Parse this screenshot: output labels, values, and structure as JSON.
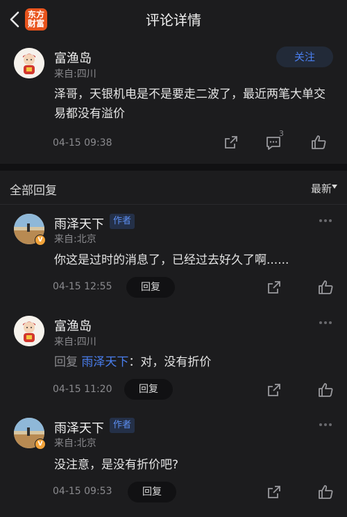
{
  "header": {
    "title": "评论详情",
    "logo_line1": "东方",
    "logo_line2": "财富"
  },
  "post": {
    "username": "富渔岛",
    "location": "来自:四川",
    "follow_label": "关注",
    "content": "泽哥，天银机电是不是要走二波了，最近两笔大单交易都没有溢价",
    "time": "04-15 09:38",
    "comment_count": "3"
  },
  "replies_section": {
    "title": "全部回复",
    "sort": "最新"
  },
  "replies": [
    {
      "username": "雨泽天下",
      "tag": "作者",
      "location": "来自:北京",
      "content": "你这是过时的消息了，已经过去好久了啊......",
      "time": "04-15 12:55",
      "reply_label": "回复"
    },
    {
      "username": "富渔岛",
      "location": "来自:四川",
      "reply_prefix": "回复",
      "reply_target": "雨泽天下",
      "content": "：对，没有折价",
      "time": "04-15 11:20",
      "reply_label": "回复"
    },
    {
      "username": "雨泽天下",
      "tag": "作者",
      "location": "来自:北京",
      "content": "没注意，是没有折价吧?",
      "time": "04-15 09:53",
      "reply_label": "回复"
    }
  ],
  "colors": {
    "background": "#1c1c1e",
    "accent": "#4a7ff0",
    "brand": "#e8531c"
  }
}
